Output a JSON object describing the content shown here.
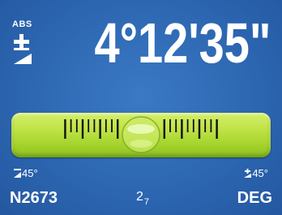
{
  "header": {
    "mode_label": "ABS",
    "angle_readout": "4°12'35\""
  },
  "icons": {
    "abs_mode": "plus-minus-slope-icon",
    "minus_range": "minus-slope-icon",
    "plus_range": "plus-slope-icon"
  },
  "level": {
    "bubble_offset": 0
  },
  "range": {
    "minus_label": "45°",
    "plus_label": "45°"
  },
  "footer": {
    "left": "N2673",
    "mid_main": "2",
    "mid_sub": "7",
    "right": "DEG"
  },
  "colors": {
    "background": "#2d67b2",
    "vial": "#b8df3e",
    "text": "#ffffff"
  }
}
